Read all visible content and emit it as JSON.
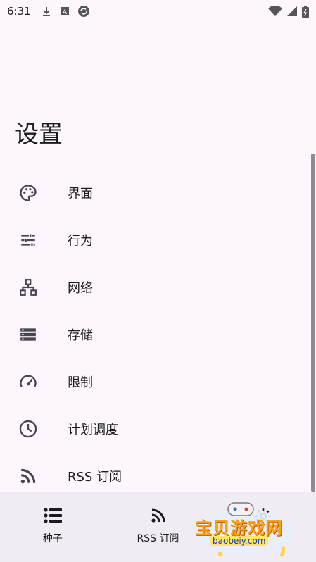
{
  "status_bar": {
    "time": "6:31",
    "left_icons": [
      "download-icon",
      "a-box-icon",
      "sync-circle-icon"
    ],
    "right_icons": [
      "wifi-icon",
      "cellular-icon",
      "battery-icon"
    ]
  },
  "page": {
    "title": "设置"
  },
  "settings": {
    "items": [
      {
        "label": "界面",
        "icon": "palette-icon"
      },
      {
        "label": "行为",
        "icon": "tune-sliders-icon"
      },
      {
        "label": "网络",
        "icon": "network-tree-icon"
      },
      {
        "label": "存储",
        "icon": "storage-icon"
      },
      {
        "label": "限制",
        "icon": "speedometer-icon"
      },
      {
        "label": "计划调度",
        "icon": "clock-icon"
      },
      {
        "label": "RSS 订阅",
        "icon": "rss-icon"
      }
    ]
  },
  "bottom_nav": {
    "items": [
      {
        "label": "种子",
        "icon": "list-icon"
      },
      {
        "label": "RSS 订阅",
        "icon": "rss-icon"
      },
      {
        "label": "",
        "icon": "settings-icon"
      }
    ]
  },
  "watermark": {
    "text": "宝贝游戏网",
    "url": "baobeiy.com"
  },
  "colors": {
    "background": "#fdf7fd",
    "nav_background": "#f1ebf3",
    "icon": "#49454f",
    "text": "#1c1b1f"
  }
}
